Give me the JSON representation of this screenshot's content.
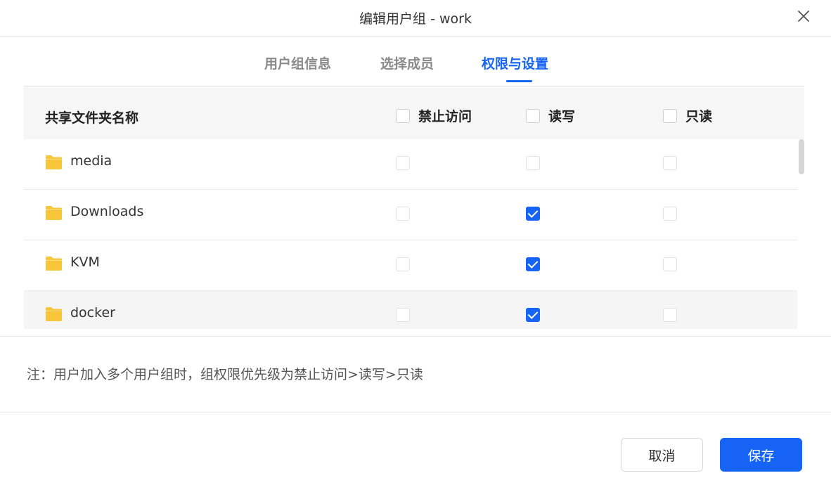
{
  "dialog": {
    "title": "编辑用户组 - work"
  },
  "tabs": [
    {
      "label": "用户组信息",
      "active": false
    },
    {
      "label": "选择成员",
      "active": false
    },
    {
      "label": "权限与设置",
      "active": true
    }
  ],
  "table": {
    "headers": {
      "name": "共享文件夹名称",
      "deny": "禁止访问",
      "read_write": "读写",
      "read_only": "只读"
    },
    "rows": [
      {
        "name": "media",
        "deny": false,
        "read_write": false,
        "read_only": false
      },
      {
        "name": "Downloads",
        "deny": false,
        "read_write": true,
        "read_only": false
      },
      {
        "name": "KVM",
        "deny": false,
        "read_write": true,
        "read_only": false
      },
      {
        "name": "docker",
        "deny": false,
        "read_write": true,
        "read_only": false
      }
    ]
  },
  "note": "注：用户加入多个用户组时，组权限优先级为禁止访问>读写>只读",
  "buttons": {
    "cancel": "取消",
    "save": "保存"
  },
  "colors": {
    "accent": "#1664f5",
    "folder": "#f9c53a"
  }
}
